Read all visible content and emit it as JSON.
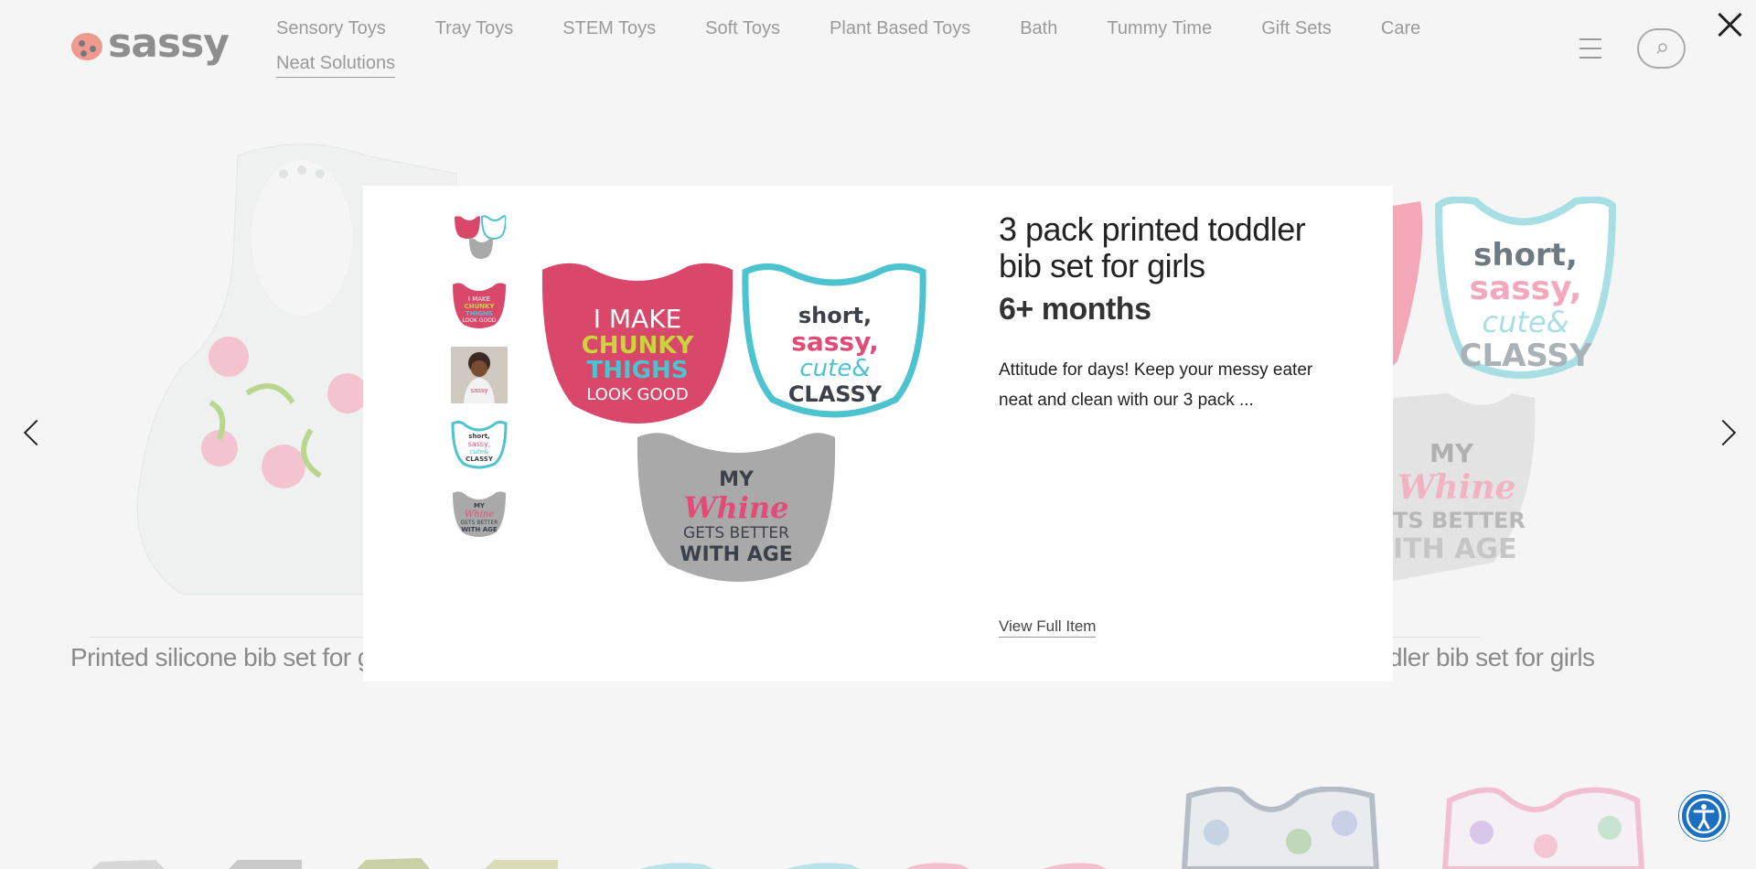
{
  "brand": {
    "logo_text": "sassy"
  },
  "nav": {
    "items": [
      {
        "label": "Sensory Toys"
      },
      {
        "label": "Tray Toys"
      },
      {
        "label": "STEM Toys"
      },
      {
        "label": "Soft Toys"
      },
      {
        "label": "Plant Based Toys"
      },
      {
        "label": "Bath"
      },
      {
        "label": "Tummy Time"
      },
      {
        "label": "Gift Sets"
      },
      {
        "label": "Care"
      },
      {
        "label": "Neat Solutions"
      }
    ],
    "active": "Neat Solutions"
  },
  "icons": {
    "menu": "hamburger-icon",
    "search": "search-icon",
    "close": "close-icon",
    "prev": "chevron-left-icon",
    "next": "chevron-right-icon",
    "accessibility": "accessibility-icon"
  },
  "background": {
    "left_product_title": "Printed silicone bib set for g",
    "right_product_title": "dler bib set for girls"
  },
  "modal": {
    "title": "3 pack printed toddler bib set for girls",
    "subtitle": "6+ months",
    "description": "Attitude for days! Keep your messy eater neat and clean with our 3 pack ...",
    "view_full_label": "View Full Item",
    "bibs": {
      "pink": [
        "I MAKE",
        "CHUNKY",
        "THIGHS",
        "LOOK GOOD"
      ],
      "white": [
        "short,",
        "sassy,",
        "cute&",
        "CLASSY"
      ],
      "gray": [
        "MY",
        "Whine",
        "GETS BETTER",
        "WITH AGE"
      ]
    }
  },
  "colors": {
    "bib_pink": "#d9476b",
    "bib_teal": "#4cc3cf",
    "bib_gray": "#a9a9a9",
    "accessibility_blue": "#1a6fc0"
  }
}
